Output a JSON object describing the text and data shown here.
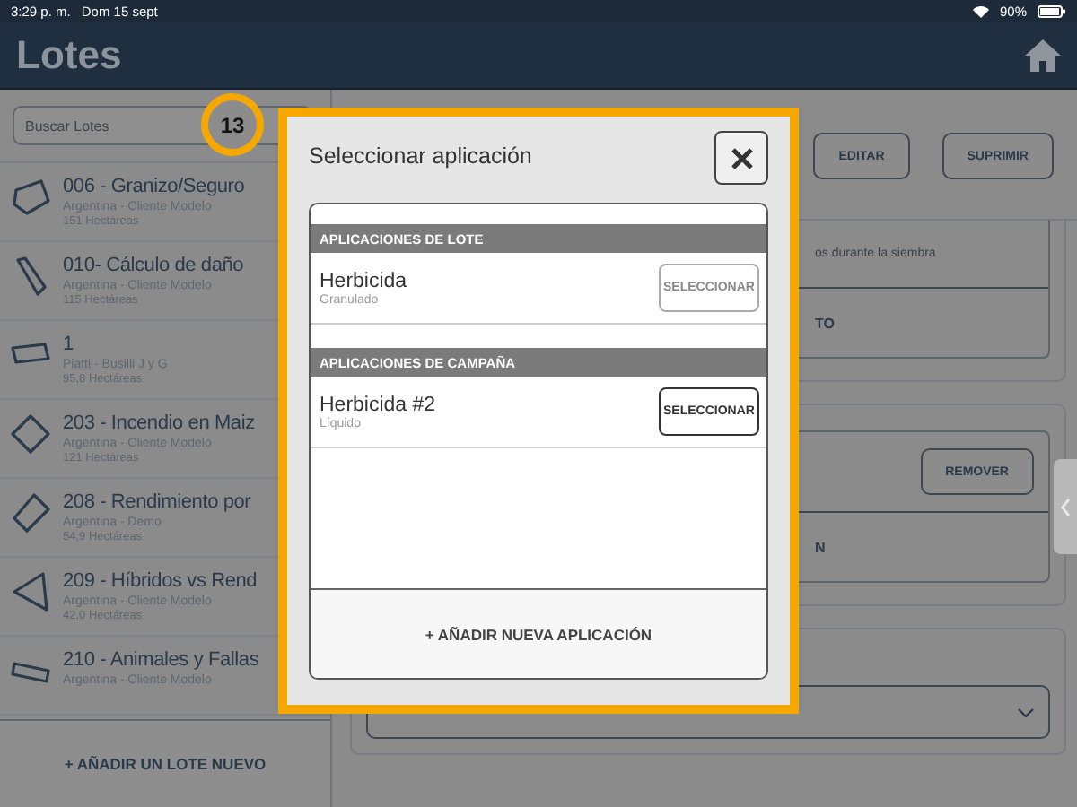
{
  "status_bar": {
    "time": "3:29 p. m.",
    "date": "Dom 15 sept",
    "battery": "90%"
  },
  "header": {
    "title": "Lotes"
  },
  "search": {
    "placeholder": "Buscar Lotes"
  },
  "badge": "13",
  "lotes": [
    {
      "name": "006 - Granizo/Seguro",
      "owner": "Argentina - Cliente Modelo",
      "area": "151 Hectáreas"
    },
    {
      "name": "010- Cálculo de daño",
      "owner": "Argentina - Cliente Modelo",
      "area": "115 Hectáreas"
    },
    {
      "name": "1",
      "owner": "Piatti - Busilli J y G",
      "area": "95,8 Hectáreas"
    },
    {
      "name": "203 - Incendio en Maiz",
      "owner": "Argentina - Cliente Modelo",
      "area": "121 Hectáreas"
    },
    {
      "name": "208 - Rendimiento por",
      "owner": "Argentina - Demo",
      "area": "54,9 Hectáreas"
    },
    {
      "name": "209 - Híbridos vs Rend",
      "owner": "Argentina - Cliente Modelo",
      "area": "42,0 Hectáreas"
    },
    {
      "name": "210 - Animales y Fallas",
      "owner": "Argentina - Cliente Modelo"
    }
  ],
  "add_lote_button": "+ AÑADIR UN LOTE NUEVO",
  "detail": {
    "buttons": [
      "EDITAR",
      "SUPRIMIR"
    ],
    "card_1": {
      "note": "os durante la siembra",
      "row_2": "TO"
    },
    "card_2": {
      "button": "REMOVER",
      "row_2": "N"
    }
  },
  "modal": {
    "title": "Seleccionar aplicación",
    "sections": [
      {
        "heading": "APLICACIONES DE LOTE",
        "items": [
          {
            "name": "Herbicida",
            "type": "Granulado",
            "button": "SELECCIONAR",
            "disabled": true
          }
        ]
      },
      {
        "heading": "APLICACIONES DE CAMPAÑA",
        "items": [
          {
            "name": "Herbicida #2",
            "type": "Líquido",
            "button": "SELECCIONAR",
            "disabled": false
          }
        ]
      }
    ],
    "add_button": "+ AÑADIR NUEVA APLICACIÓN"
  }
}
